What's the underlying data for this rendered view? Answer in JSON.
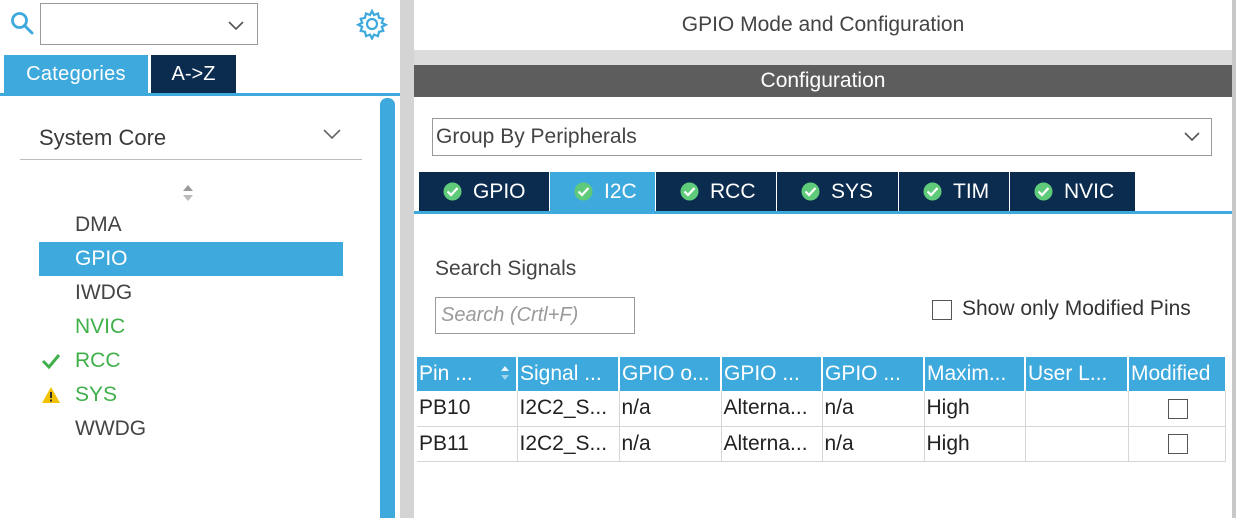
{
  "left_panel": {
    "search": {
      "value": "",
      "placeholder": ""
    },
    "tabs": {
      "categories": "Categories",
      "a_to_z": "A->Z"
    },
    "category_group": {
      "title": "System Core"
    },
    "items": [
      {
        "label": "DMA",
        "state": "none"
      },
      {
        "label": "GPIO",
        "state": "selected"
      },
      {
        "label": "IWDG",
        "state": "none"
      },
      {
        "label": "NVIC",
        "state": "green"
      },
      {
        "label": "RCC",
        "state": "check"
      },
      {
        "label": "SYS",
        "state": "warning"
      },
      {
        "label": "WWDG",
        "state": "none"
      }
    ],
    "colors": {
      "accent": "#3ea9dc",
      "dark_tab": "#0b2b4f",
      "ok_green": "#40b04a",
      "warning": "#f2c200"
    }
  },
  "right_panel": {
    "title": "GPIO Mode and Configuration",
    "configuration_header": "Configuration",
    "group_by": "Group By Peripherals",
    "peripheral_tabs": [
      {
        "label": "GPIO",
        "active": false
      },
      {
        "label": "I2C",
        "active": true
      },
      {
        "label": "RCC",
        "active": false
      },
      {
        "label": "SYS",
        "active": false
      },
      {
        "label": "TIM",
        "active": false
      },
      {
        "label": "NVIC",
        "active": false
      }
    ],
    "search_signals": {
      "label": "Search Signals",
      "placeholder": "Search (Crtl+F)",
      "value": ""
    },
    "show_modified": {
      "label": "Show only Modified Pins",
      "checked": false
    },
    "table": {
      "columns": [
        "Pin ...",
        "Signal ...",
        "GPIO o...",
        "GPIO ...",
        "GPIO ...",
        "Maxim...",
        "User L...",
        "Modified"
      ],
      "rows": [
        [
          "PB10",
          "I2C2_S...",
          "n/a",
          "Alterna...",
          "n/a",
          "High",
          "",
          ""
        ],
        [
          "PB11",
          "I2C2_S...",
          "n/a",
          "Alterna...",
          "n/a",
          "High",
          "",
          ""
        ]
      ],
      "modified": [
        false,
        false
      ]
    }
  }
}
